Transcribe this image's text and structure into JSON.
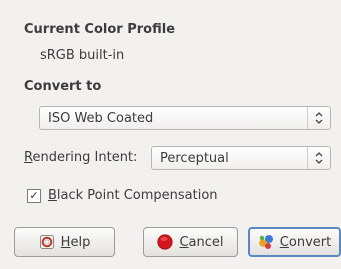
{
  "current_profile": {
    "title": "Current Color Profile",
    "value": "sRGB built-in"
  },
  "convert_to": {
    "title": "Convert to",
    "selected": "ISO Web Coated"
  },
  "rendering_intent": {
    "label_first": "R",
    "label_rest": "endering Intent:",
    "selected": "Perceptual"
  },
  "black_point": {
    "checked_mark": "✓",
    "label_first": "B",
    "label_rest": "lack Point Compensation"
  },
  "buttons": {
    "help_first": "H",
    "help_rest": "elp",
    "cancel_first": "C",
    "cancel_rest": "ancel",
    "convert_first": "C",
    "convert_rest": "onvert"
  },
  "icons": {
    "combo_arrow": "chevron-updown-icon",
    "help": "help-icon",
    "cancel": "cancel-icon",
    "convert": "convert-icon"
  },
  "colors": {
    "cancel_red": "#d4171e",
    "default_border": "#5a88c0"
  }
}
